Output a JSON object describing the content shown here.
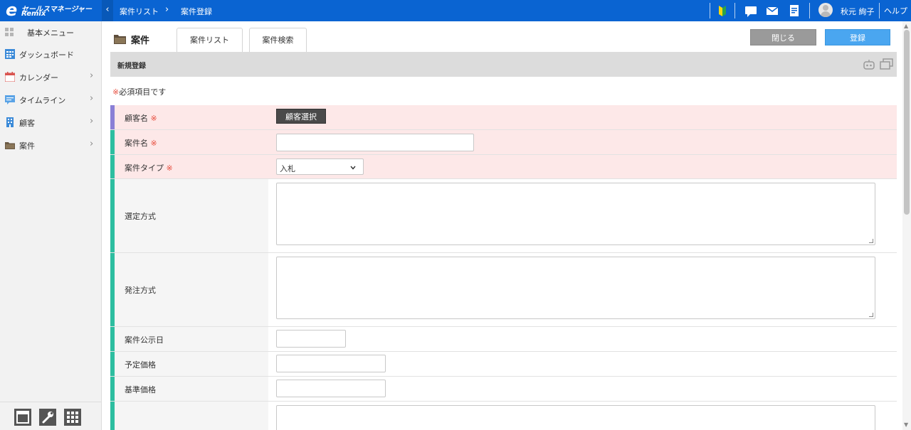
{
  "app": {
    "logo_main": "セールスマネージャー",
    "logo_sub": "Remix",
    "logo_e": "e"
  },
  "breadcrumb": {
    "back": "‹",
    "item1": "案件リスト",
    "sep": "›",
    "item2": "案件登録"
  },
  "header": {
    "user_name": "秋元 絢子",
    "help": "ヘルプ"
  },
  "sidebar": {
    "title": "基本メニュー",
    "items": [
      {
        "label": "ダッシュボード",
        "icon": "dashboard-icon",
        "chevron": ""
      },
      {
        "label": "カレンダー",
        "icon": "calendar-icon",
        "chevron": "›"
      },
      {
        "label": "タイムライン",
        "icon": "timeline-icon",
        "chevron": "›"
      },
      {
        "label": "顧客",
        "icon": "building-icon",
        "chevron": "›"
      },
      {
        "label": "案件",
        "icon": "folder-icon",
        "chevron": "›"
      }
    ]
  },
  "page": {
    "title": "案件",
    "tabs": [
      "案件リスト",
      "案件検索"
    ],
    "close_label": "閉じる",
    "register_label": "登録",
    "section_title": "新規登録",
    "required_mark": "※",
    "required_note": "必須項目です"
  },
  "form": {
    "customer_label": "顧客名",
    "customer_button": "顧客選択",
    "deal_name_label": "案件名",
    "deal_name_value": "",
    "deal_type_label": "案件タイプ",
    "deal_type_value": "入札",
    "selection_method_label": "選定方式",
    "order_method_label": "発注方式",
    "public_date_label": "案件公示日",
    "planned_price_label": "予定価格",
    "base_price_label": "基準価格"
  },
  "colors": {
    "topbar": "#0a64d2",
    "required_row": "#fde8e8",
    "required_bar": "#8a7fd6",
    "optional_bar": "#2dbea0"
  }
}
